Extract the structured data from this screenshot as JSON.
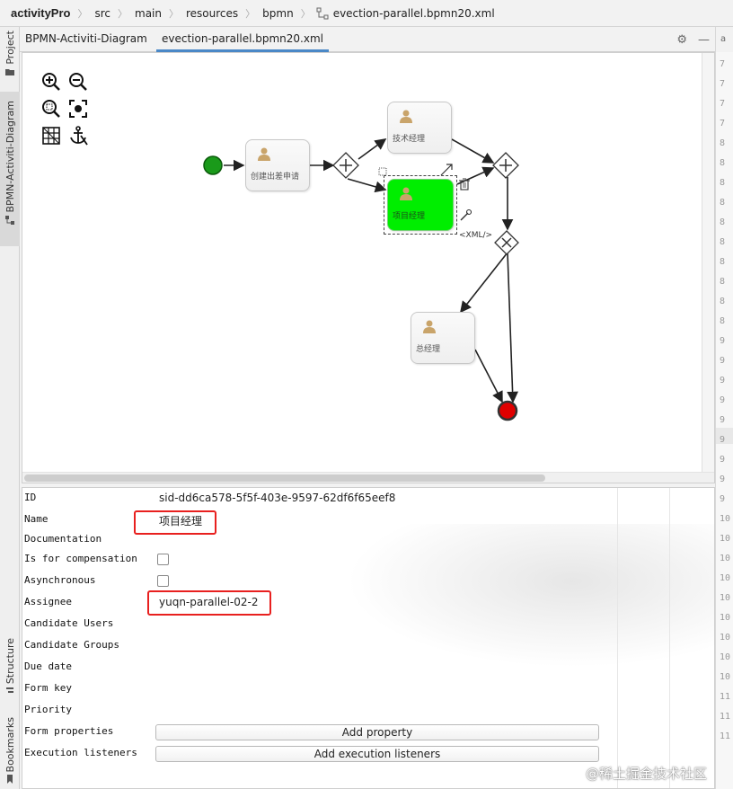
{
  "breadcrumb": {
    "items": [
      "activityPro",
      "src",
      "main",
      "resources",
      "bpmn",
      "evection-parallel.bpmn20.xml"
    ]
  },
  "left_strip": {
    "project": "Project",
    "diagram": "BPMN-Activiti-Diagram",
    "structure": "Structure",
    "bookmarks": "Bookmarks"
  },
  "tabs": {
    "diagram": "BPMN-Activiti-Diagram",
    "file": "evection-parallel.bpmn20.xml"
  },
  "gutter": {
    "top_label": "a",
    "line_numbers": [
      "7",
      "7",
      "7",
      "7",
      "8",
      "8",
      "8",
      "8",
      "8",
      "8",
      "8",
      "8",
      "8",
      "8",
      "9",
      "9",
      "9",
      "9",
      "9",
      "9",
      "9",
      "9",
      "9",
      "10",
      "10",
      "10",
      "10",
      "10",
      "10",
      "10",
      "10",
      "10",
      "11",
      "11",
      "11"
    ]
  },
  "diagram": {
    "tasks": {
      "apply": "创建出差申请",
      "tech_manager": "技术经理",
      "project_manager": "项目经理",
      "general_manager": "总经理"
    },
    "xml_tag": "<XML/>"
  },
  "properties": {
    "id_label": "ID",
    "id_value": "sid-dd6ca578-5f5f-403e-9597-62df6f65eef8",
    "name_label": "Name",
    "name_value": "项目经理",
    "documentation_label": "Documentation",
    "compensation_label": "Is for compensation",
    "async_label": "Asynchronous",
    "assignee_label": "Assignee",
    "assignee_value": "yuqn-parallel-02-2",
    "candidate_users_label": "Candidate Users",
    "candidate_groups_label": "Candidate Groups",
    "due_date_label": "Due date",
    "form_key_label": "Form key",
    "priority_label": "Priority",
    "form_properties_label": "Form properties",
    "add_property": "Add property",
    "execution_listeners_label": "Execution listeners",
    "add_execution_listeners": "Add execution listeners"
  },
  "watermark": "@稀土掘金技术社区",
  "colors": {
    "start_event": "#1a9a1a",
    "end_event": "#e00000",
    "selected_task": "#00ee00",
    "highlight": "#e8201f",
    "active_tab": "#4a88c7"
  },
  "icons": [
    "zoom-in-icon",
    "zoom-out-icon",
    "zoom-fit-icon",
    "focus-icon",
    "grid-icon",
    "anchor-icon",
    "settings-icon",
    "minimize-icon",
    "trash-icon",
    "wrench-icon",
    "user-icon"
  ]
}
